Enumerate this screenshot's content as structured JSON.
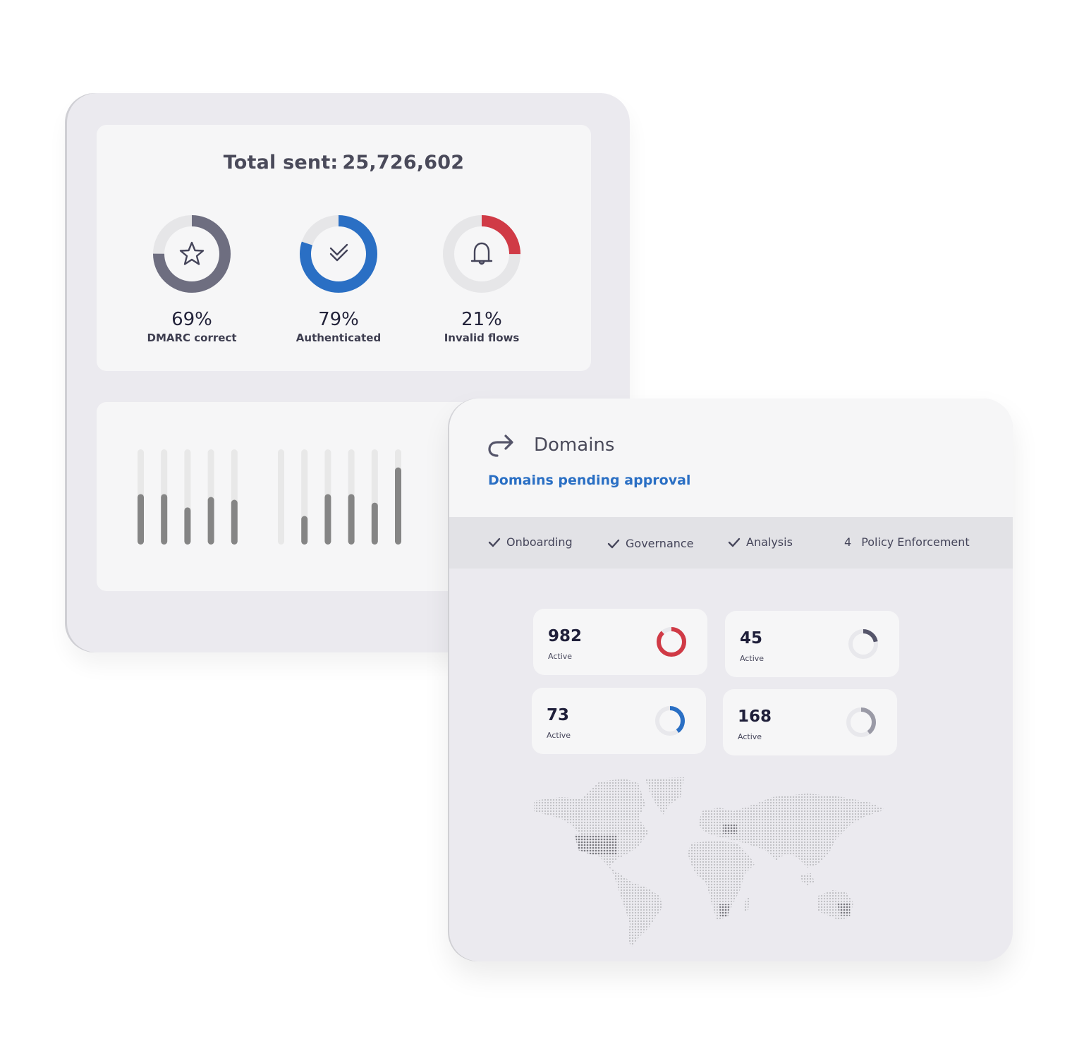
{
  "summary": {
    "title_prefix": "Total sent:",
    "total_sent": "25,726,602",
    "kpis": [
      {
        "percent_label": "69%",
        "label": "DMARC correct",
        "fill_fraction": 0.75,
        "color": "#6e6e80",
        "icon": "star-icon"
      },
      {
        "percent_label": "79%",
        "label": "Authenticated",
        "fill_fraction": 0.8,
        "color": "#2a6fc4",
        "icon": "double-check-icon"
      },
      {
        "percent_label": "21%",
        "label": "Invalid flows",
        "fill_fraction": 0.25,
        "color": "#d03a46",
        "icon": "bell-icon"
      }
    ]
  },
  "bars": {
    "groups": [
      [
        0.53,
        0.53,
        0.39,
        0.5,
        0.47
      ],
      [
        0.0,
        0.3,
        0.53,
        0.53,
        0.44,
        0.81
      ]
    ],
    "fill_color": "#858585",
    "track_color": "#e8e8e8"
  },
  "domains": {
    "title": "Domains",
    "icon": "redo-arrow-icon",
    "subtitle": "Domains pending approval",
    "accent": "#2a6fc4",
    "steps": [
      {
        "marker": "check",
        "label": "Onboarding"
      },
      {
        "marker": "check",
        "label": "Governance"
      },
      {
        "marker": "check",
        "label": "Analysis"
      },
      {
        "marker": "4",
        "label": "Policy Enforcement"
      }
    ],
    "stats": [
      {
        "value": "982",
        "label": "Active",
        "fill_fraction": 0.88,
        "color": "#d03a46"
      },
      {
        "value": "45",
        "label": "Active",
        "fill_fraction": 0.22,
        "color": "#55556a"
      },
      {
        "value": "73",
        "label": "Active",
        "fill_fraction": 0.4,
        "color": "#2a6fc4"
      },
      {
        "value": "168",
        "label": "Active",
        "fill_fraction": 0.4,
        "color": "#9a9aa6"
      }
    ]
  }
}
